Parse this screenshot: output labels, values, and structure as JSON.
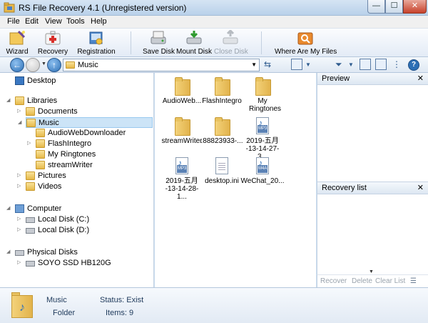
{
  "window": {
    "title": "RS File Recovery 4.1 (Unregistered version)",
    "min": "—",
    "max": "☐",
    "close": "✕"
  },
  "menu": [
    "File",
    "Edit",
    "View",
    "Tools",
    "Help"
  ],
  "toolbar": {
    "wizard": "Wizard",
    "recovery": "Recovery",
    "registration": "Registration",
    "save_disk": "Save Disk",
    "mount_disk": "Mount Disk",
    "close_disk": "Close Disk",
    "where": "Where Are My Files"
  },
  "address": {
    "path": "Music"
  },
  "tree": {
    "desktop": "Desktop",
    "libraries": "Libraries",
    "documents": "Documents",
    "music": "Music",
    "music_children": [
      "AudioWebDownloader",
      "FlashIntegro",
      "My Ringtones",
      "streamWriter"
    ],
    "pictures": "Pictures",
    "videos": "Videos",
    "computer": "Computer",
    "disk_c": "Local Disk (C:)",
    "disk_d": "Local Disk (D:)",
    "physical": "Physical Disks",
    "ssd": "SOYO SSD HB120G"
  },
  "files": [
    {
      "name": "AudioWeb...",
      "kind": "folder"
    },
    {
      "name": "FlashIntegro",
      "kind": "folder"
    },
    {
      "name": "My Ringtones",
      "kind": "folder"
    },
    {
      "name": "streamWriter",
      "kind": "folder"
    },
    {
      "name": ".88823933-...",
      "kind": "folder"
    },
    {
      "name": "2019-五月 -13-14-27-3...",
      "kind": "mp3",
      "tag": "MP3"
    },
    {
      "name": "2019-五月 -13-14-28-1...",
      "kind": "mp3",
      "tag": "MP3"
    },
    {
      "name": "desktop.ini",
      "kind": "blank"
    },
    {
      "name": "WeChat_20...",
      "kind": "m4a",
      "tag": "M4A"
    }
  ],
  "panes": {
    "preview": "Preview",
    "recovery_list": "Recovery list",
    "close": "✕"
  },
  "recovery_toolbar": {
    "recover": "Recover",
    "delete": "Delete",
    "clear": "Clear List"
  },
  "status": {
    "name": "Music",
    "type": "Folder",
    "status": "Status: Exist",
    "items": "Items: 9"
  }
}
